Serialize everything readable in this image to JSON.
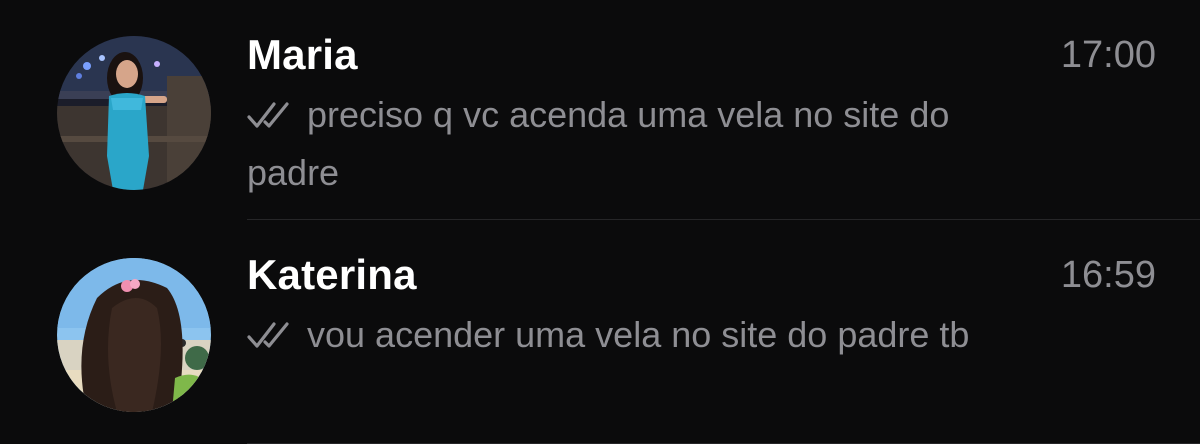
{
  "chats": [
    {
      "name": "Maria",
      "time": "17:00",
      "message": "preciso q vc acenda uma vela no site do padre",
      "status_icon": "double-check-icon"
    },
    {
      "name": "Katerina",
      "time": "16:59",
      "message": "vou acender uma vela no site do padre tb",
      "status_icon": "double-check-icon"
    }
  ],
  "colors": {
    "background": "#0b0b0c",
    "name": "#ffffff",
    "secondary_text": "#8e8e93",
    "divider": "#262628"
  }
}
